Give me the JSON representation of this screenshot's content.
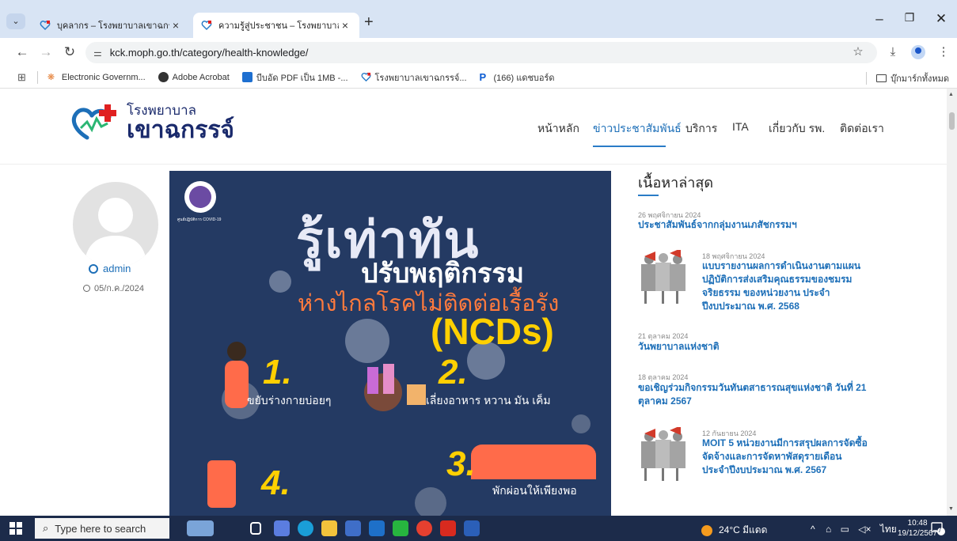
{
  "browser": {
    "tabs": [
      {
        "label": "บุคลากร – โรงพยาบาลเขาฉกรรจ์",
        "active": false
      },
      {
        "label": "ความรู้สู่ประชาชน – โรงพยาบาลเขาฉ",
        "active": true
      }
    ],
    "url": "kck.moph.go.th/category/health-knowledge/",
    "bookmarks": [
      {
        "label": "Electronic Governm...",
        "icon": "egov-icon"
      },
      {
        "label": "Adobe Acrobat",
        "icon": "acrobat-icon"
      },
      {
        "label": "บีบอัด PDF เป็น 1MB -...",
        "icon": "compress-icon"
      },
      {
        "label": "โรงพยาบาลเขาฉกรรจ์...",
        "icon": "hospital-heart-icon"
      },
      {
        "label": "(166) แดชบอร์ด",
        "icon": "p-icon"
      }
    ],
    "all_bookmarks": "บุ๊กมาร์กทั้งหมด"
  },
  "site": {
    "logo_small": "โรงพยาบาล",
    "logo_big": "เขาฉกรรจ์",
    "nav": [
      "หน้าหลัก",
      "ข่าวประชาสัมพันธ์",
      "บริการ",
      "ITA",
      "เกี่ยวกับ รพ.",
      "ติดต่อเรา"
    ],
    "active_nav": "ข่าวประชาสัมพันธ์"
  },
  "post": {
    "author": "admin",
    "date": "05/ก.ค./2024",
    "hero": {
      "line1": "รู้เท่าทัน",
      "line2": "ปรับพฤติกรรม",
      "line3": "ห่างไกลโรคไม่ติดต่อเรื้อรัง",
      "line4": "(NCDs)",
      "badge": "ศูนย์ปฏิบัติการ COVID-19",
      "steps": [
        {
          "num": "1.",
          "label": "ขยับร่างกายบ่อยๆ"
        },
        {
          "num": "2.",
          "label": "เลี่ยงอาหาร หวาน มัน เค็ม"
        },
        {
          "num": "3.",
          "label": "พักผ่อนให้เพียงพอ"
        },
        {
          "num": "4.",
          "label": ""
        }
      ]
    }
  },
  "sidebar": {
    "title": "เนื้อหาล่าสุด",
    "items": [
      {
        "date": "26 พฤศจิกายน 2024",
        "title": "ประชาสัมพันธ์จากกลุ่มงานเภสัชกรรมฯ",
        "thumb": false
      },
      {
        "date": "18 พฤศจิกายน 2024",
        "title": "แบบรายงานผลการดำเนินงานตามแผนปฏิบัติการส่งเสริมคุณธรรมของชมรมจริยธรรม ของหน่วยงาน ประจำปีงบประมาณ พ.ศ. 2568",
        "thumb": true
      },
      {
        "date": "21 ตุลาคม 2024",
        "title": "วันพยาบาลแห่งชาติ",
        "thumb": false
      },
      {
        "date": "18 ตุลาคม 2024",
        "title": "ขอเชิญร่วมกิจกรรมวันทันตสาธารณสุขแห่งชาติ วันที่ 21 ตุลาคม 2567",
        "thumb": false
      },
      {
        "date": "12 กันยายน 2024",
        "title": "MOIT 5 หน่วยงานมีการสรุปผลการจัดซื้อจัดจ้างและการจัดหาพัสดุรายเดือน ประจำปีงบประมาณ พ.ศ. 2567",
        "thumb": true
      }
    ]
  },
  "taskbar": {
    "search_placeholder": "Type here to search",
    "weather": "24°C มีแดด",
    "lang": "ไทย",
    "time": "10:48",
    "date": "19/12/2567",
    "notif_count": "7"
  }
}
